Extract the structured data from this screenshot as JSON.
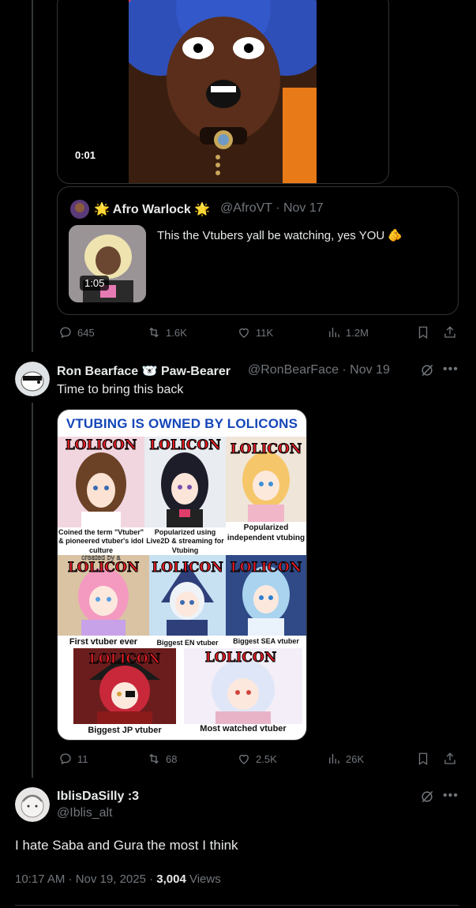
{
  "video": {
    "time": "0:01"
  },
  "quote": {
    "name": "🌟 Afro Warlock 🌟",
    "handle": "@AfroVT · Nov 17",
    "text": "This the Vtubers yall be watching, yes YOU 🫵",
    "thumb_time": "1:05"
  },
  "post1_actions": {
    "replies": "645",
    "reposts": "1.6K",
    "likes": "11K",
    "views": "1.2M"
  },
  "post2": {
    "name": "Ron Bearface 🐻‍❄️ Paw-Bearer",
    "handle": "@RonBearFace · Nov 19",
    "text": "Time to bring this back"
  },
  "meme": {
    "title": "VTUBING IS OWNED BY LOLICONS",
    "stamp": "LOLICON",
    "overlay": "created by a",
    "captions": [
      "Coined the term \"Vtuber\" & pioneered vtuber's idol culture",
      "Popularized using Live2D & streaming for Vtubing",
      "Popularized independent vtubing",
      "First vtuber ever",
      "Biggest EN vtuber",
      "Biggest SEA vtuber",
      "Biggest JP vtuber",
      "Most watched vtuber"
    ]
  },
  "post2_actions": {
    "replies": "11",
    "reposts": "68",
    "likes": "2.5K",
    "views": "26K"
  },
  "reply": {
    "name": "IblisDaSilly :3",
    "handle": "@Iblis_alt",
    "text": "I hate Saba and Gura the most I think",
    "time": "10:17 AM · Nov 19, 2025 · ",
    "views_count": "3,004",
    "views_label": " Views"
  },
  "colors": {
    "background": "#000000",
    "muted": "#71767b",
    "text": "#e7e9ea",
    "border": "#2f3336",
    "stamp": "#e31c24",
    "title_blue": "#1546b8"
  }
}
